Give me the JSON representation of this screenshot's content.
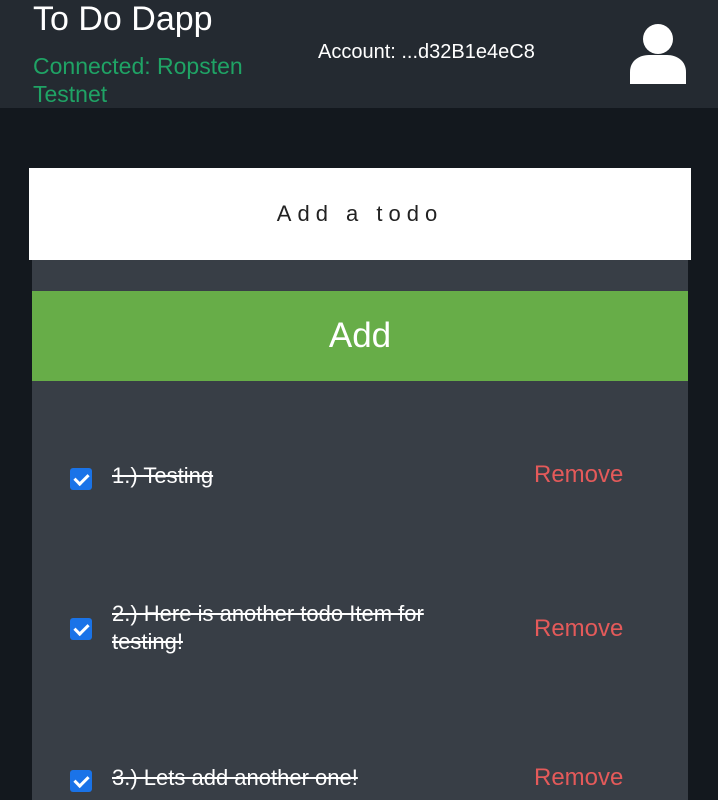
{
  "header": {
    "title": "To Do Dapp",
    "network_status": "Connected: Ropsten Testnet",
    "account": "Account: ...d32B1e4eC8"
  },
  "icons": {
    "avatar": "user-icon"
  },
  "form": {
    "placeholder": "Add a todo",
    "add_label": "Add"
  },
  "todos": [
    {
      "text": "1.) Testing",
      "checked": true,
      "remove_label": "Remove"
    },
    {
      "text": "2.) Here is another todo Item for testing!",
      "checked": true,
      "remove_label": "Remove"
    },
    {
      "text": "3.) Lets add another one!",
      "checked": true,
      "remove_label": "Remove"
    }
  ],
  "colors": {
    "header_bg": "#242a31",
    "page_bg": "#13181e",
    "panel_bg": "#383e46",
    "accent_green": "#67ad48",
    "status_green": "#1fa365",
    "remove_red": "#e45a5a",
    "checkbox_blue": "#1a73e8"
  }
}
